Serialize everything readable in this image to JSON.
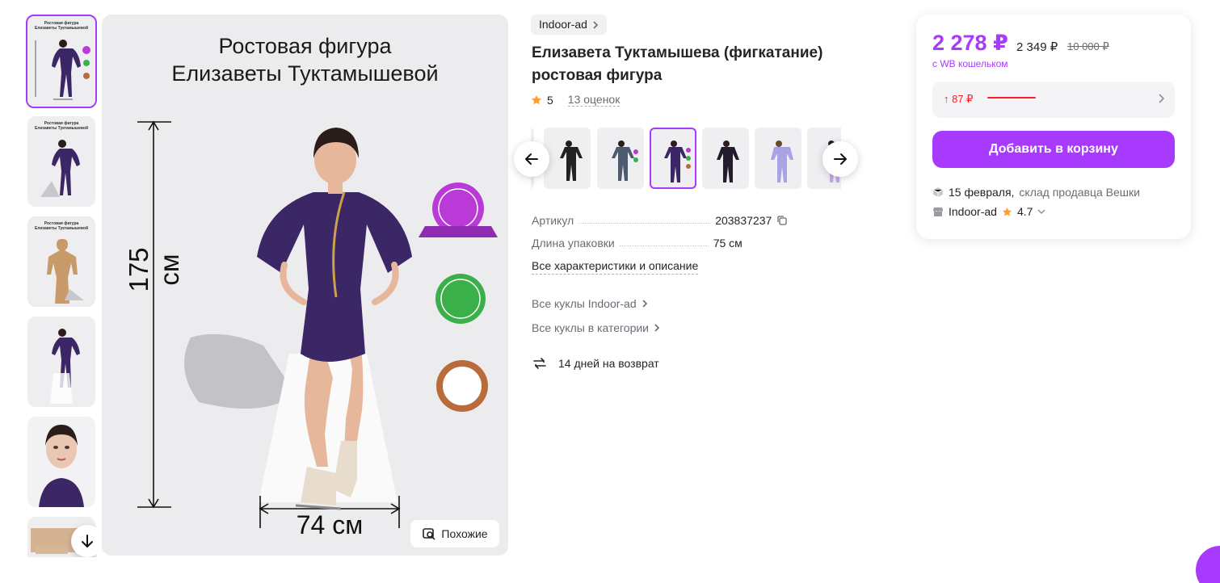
{
  "gallery": {
    "thumb_titles": [
      "Ростовая фигура\nЕлизаветы Туктамышевой",
      "Ростовая фигура\nЕлизаветы Туктамышевой",
      "Ростовая фигура\nЕлизаветы Туктамышевой"
    ],
    "main_title_line1": "Ростовая фигура",
    "main_title_line2": "Елизаветы Туктамышевой",
    "height_label": "175 см",
    "width_label": "74 см",
    "similar_label": "Похожие"
  },
  "product": {
    "brand": "Indoor-ad",
    "title": "Елизавета Туктамышева (фигкатание) ростовая фигура",
    "rating": "5",
    "reviews": "13 оценок",
    "specs": [
      {
        "label": "Артикул",
        "value": "203837237"
      },
      {
        "label": "Длина упаковки",
        "value": "75 см"
      }
    ],
    "all_characteristics": "Все характеристики и описание",
    "links": [
      "Все куклы Indoor-ad",
      "Все куклы в категории"
    ],
    "return_policy": "14 дней на возврат"
  },
  "buy": {
    "price": "2 278 ₽",
    "price_without_wallet": "2 349 ₽",
    "price_old": "10 000 ₽",
    "wallet_note": "с WB кошельком",
    "price_change": "↑ 87 ₽",
    "cart_button": "Добавить в корзину",
    "delivery_date": "15 февраля,",
    "delivery_from": "склад продавца Вешки",
    "seller_name": "Indoor-ad",
    "seller_rating": "4.7"
  },
  "colors": {
    "accent": "#a73afd",
    "price_up": "#f5222d"
  }
}
